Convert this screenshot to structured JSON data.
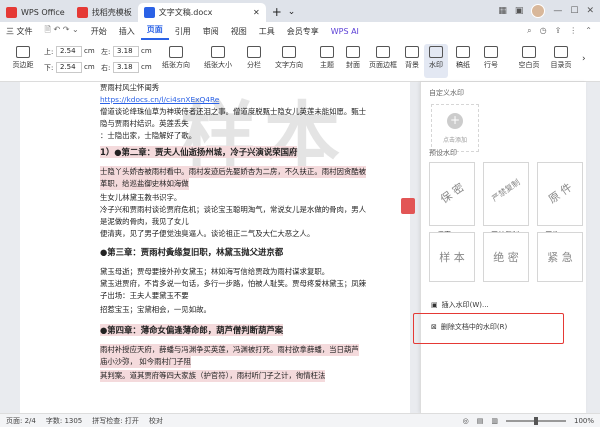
{
  "tabs": [
    {
      "label": "WPS Office",
      "color": "#e53935"
    },
    {
      "label": "找稻壳模板",
      "color": "#e53935"
    },
    {
      "label": "文字文稿.docx",
      "color": "#2b62e6"
    }
  ],
  "menu": [
    "三 文件",
    "开始",
    "插入",
    "页面",
    "引用",
    "审阅",
    "视图",
    "工具",
    "会员专享",
    "WPS AI"
  ],
  "active_menu": "页面",
  "ribbon": {
    "margin_label": "页边距",
    "top_label": "上:",
    "top_value": "2.54",
    "bottom_label": "下:",
    "bottom_value": "2.54",
    "left_label": "左:",
    "left_value": "3.18",
    "right_label": "右:",
    "right_value": "3.18",
    "unit": "cm",
    "buttons": [
      "纸张方向",
      "纸张大小",
      "分栏",
      "文字方向",
      "主题",
      "封面",
      "页面边框",
      "背景",
      "水印",
      "稿纸",
      "行号",
      "空白页",
      "目录页"
    ]
  },
  "document": {
    "watermark": "样本",
    "lines": [
      {
        "text": "贾雨村风尘怀闺秀",
        "style": "normal"
      },
      {
        "text": "https://kdocs.cn/l/ci4snXExQ4Re",
        "style": "link"
      },
      {
        "text": "僧道谈论绛珠仙草为神瑛侍者还泪之事。僧道度脱甄士隐女儿英莲未能如愿。甄士",
        "style": "normal"
      },
      {
        "text": "隐与贾雨村结识。英莲丢失",
        "style": "normal"
      },
      {
        "text": "：士隐出家，士隐解好了歌。",
        "style": "normal"
      },
      {
        "text": "1）●第二章：贾夫人仙逝扬州城，冷子兴演说荣国府",
        "style": "heading-hl"
      },
      {
        "text": "士隐丫头娇杏被雨村看中。雨村发迹后先娶娇杏为二房，不久扶正。雨村因贪酷被",
        "style": "hl"
      },
      {
        "text": "革职，给巡盐御史林如海做",
        "style": "hl"
      },
      {
        "text": "生女儿林黛玉教书识字。",
        "style": "normal"
      },
      {
        "text": "冷子兴和贾雨村谈论贾府危机；谈论宝玉聪明淘气，常说女儿是水做的骨肉，男人",
        "style": "normal"
      },
      {
        "text": "是泥做的骨肉，我见了女儿",
        "style": "normal"
      },
      {
        "text": "便清爽，见了男子便觉浊臭逼人。谈论祖正二气及大仁大恶之人。",
        "style": "normal"
      },
      {
        "text": "●第三章：贾雨村夤缘复旧职，林黛玉抛父进京都",
        "style": "heading"
      },
      {
        "text": "黛玉母逝；贾母要接外孙女黛玉；林如海写信给贾政为雨村谋求复职。",
        "style": "normal"
      },
      {
        "text": "黛玉进贾府，不肯多说一句话，多行一步路，怕被人耻笑。贾母疼爱林黛玉；凤辣",
        "style": "normal"
      },
      {
        "text": "子出场：王夫人要黛玉不要",
        "style": "normal"
      },
      {
        "text": "招惹宝玉；宝黛相会，一见如故。",
        "style": "normal"
      },
      {
        "text": "●第四章：薄命女偏逢薄命郎，葫芦僧判断葫芦案",
        "style": "heading-hl"
      },
      {
        "text": "雨村补授应天府，薛蟠与冯渊争买英莲，冯渊被打死。雨村欲拿薛蟠，当日葫芦",
        "style": "hl"
      },
      {
        "text": "庙小沙弥，  如今雨村门子阻",
        "style": "hl"
      },
      {
        "text": "其判案。道其贾府等四大家族（护官符），雨村听门子之计，徇情枉法",
        "style": "hl"
      }
    ]
  },
  "panel": {
    "custom_title": "自定义水印",
    "add_label": "点击添加",
    "preset_title": "预设水印",
    "presets": [
      {
        "text": "保 密",
        "label": "保密"
      },
      {
        "text": "严禁复制",
        "label": "严禁复制"
      },
      {
        "text": "原 件",
        "label": "原件"
      },
      {
        "text": "样 本",
        "label": "样本"
      },
      {
        "text": "绝 密",
        "label": "绝密"
      },
      {
        "text": "紧 急",
        "label": "紧急"
      }
    ],
    "insert_action": "插入水印(W)...",
    "remove_action": "删除文档中的水印(R)"
  },
  "status": {
    "page": "页面: 2/4",
    "words": "字数: 1305",
    "spell": "拼写检查: 打开",
    "proof": "校对",
    "zoom": "100%"
  },
  "colors": {
    "accent": "#2b62e6",
    "highlight": "#f4dadc",
    "red_box": "#e53935"
  }
}
